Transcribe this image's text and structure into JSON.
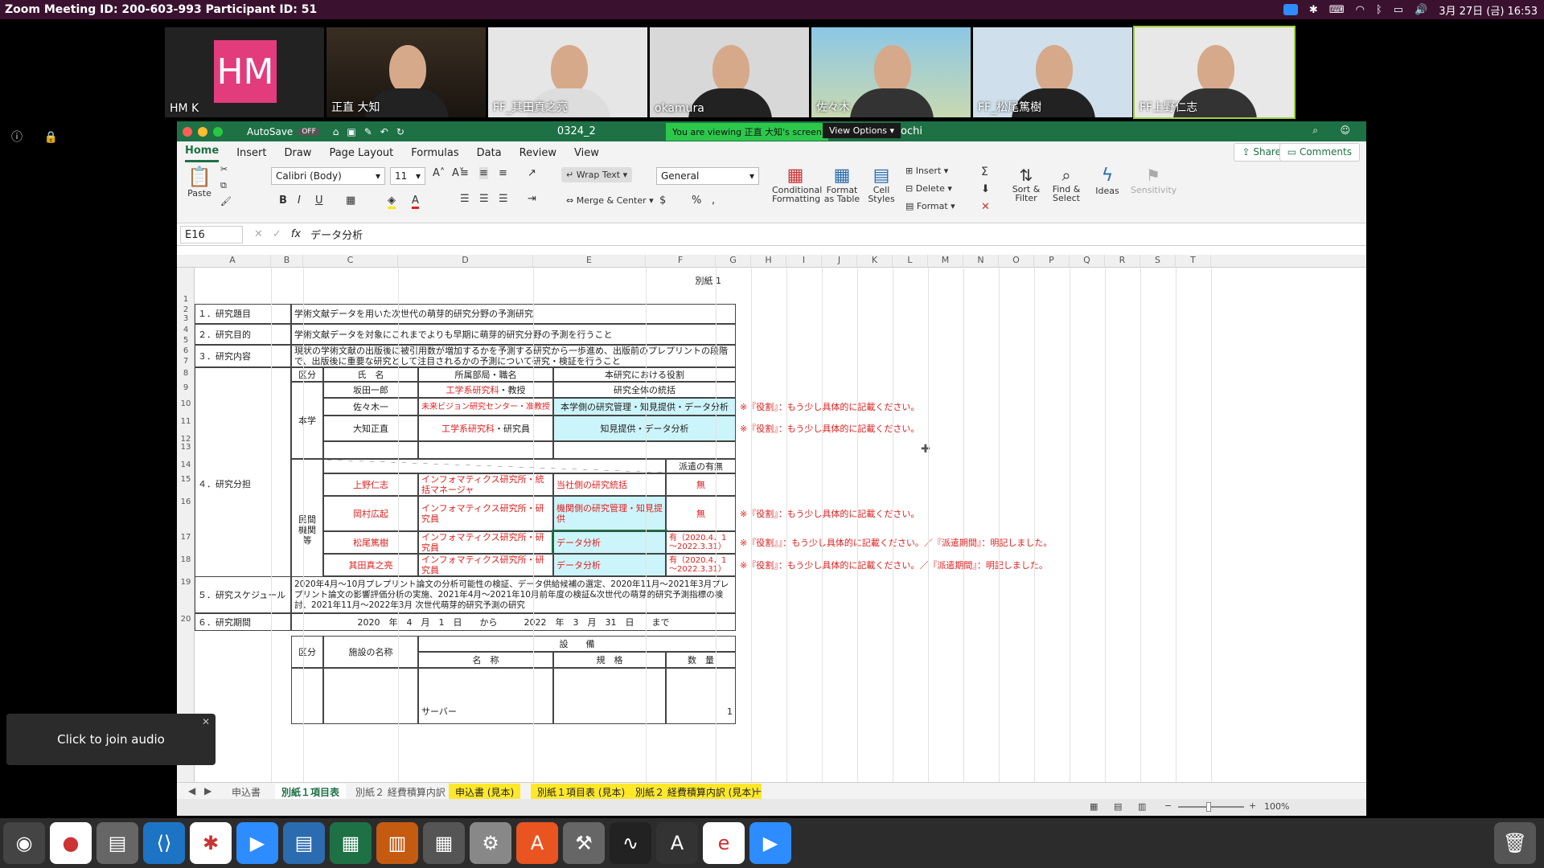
{
  "topbar": {
    "title": "Zoom Meeting ID: 200-603-993 Participant ID: 51",
    "datetime": "3月 27日 (금) 16:53"
  },
  "participants": [
    {
      "name": "HM K",
      "initials": "HM"
    },
    {
      "name": "正直 大知"
    },
    {
      "name": "FF_其田真之亮"
    },
    {
      "name": "okamura"
    },
    {
      "name": "佐々木"
    },
    {
      "name": "FF_松尾篤樹"
    },
    {
      "name": "FF上野仁志"
    }
  ],
  "excel": {
    "autosave": "AutoSave",
    "autosave_state": "OFF",
    "filename": "0324_2",
    "filename_tail": "ochi",
    "viewing_banner": "You are viewing 正直 大知's screen",
    "view_options": "View Options",
    "tabs": [
      "Home",
      "Insert",
      "Draw",
      "Page Layout",
      "Formulas",
      "Data",
      "Review",
      "View"
    ],
    "share": "Share",
    "comments": "Comments",
    "font": "Calibri (Body)",
    "font_size": "11",
    "number_format": "General",
    "ribbon": {
      "paste": "Paste",
      "wrap": "Wrap Text",
      "merge": "Merge & Center",
      "cond": "Conditional Formatting",
      "fmt_table": "Format as Table",
      "cell_styles": "Cell Styles",
      "insert": "Insert",
      "delete": "Delete",
      "format": "Format",
      "sort": "Sort & Filter",
      "find": "Find & Select",
      "ideas": "Ideas",
      "sensitivity": "Sensitivity"
    },
    "name_box": "E16",
    "formula": "データ分析",
    "columns": [
      "A",
      "B",
      "C",
      "D",
      "E",
      "F",
      "G",
      "H",
      "I",
      "J",
      "K",
      "L",
      "M",
      "N",
      "O",
      "P",
      "Q",
      "R",
      "S",
      "T"
    ],
    "rows": [
      "1",
      "2",
      "3",
      "4",
      "5",
      "6",
      "7",
      "8",
      "9",
      "10",
      "11",
      "12",
      "13",
      "14",
      "15",
      "16",
      "17",
      "18",
      "19",
      "20"
    ],
    "cells": {
      "besshi": "別紙 1",
      "r1_label": "１．研究題目",
      "r1_val": "学術文献データを用いた次世代の萌芽的研究分野の予測研究",
      "r2_label": "２．研究目的",
      "r2_val": "学術文献データを対象にこれまでよりも早期に萌芽的研究分野の予測を行うこと",
      "r3_label": "３．研究内容",
      "r3_val": "現状の学術文献の出版後に被引用数が増加するかを予測する研究から一歩進め、出版前のプレプリントの段階で、出版後に重要な研究として注目されるかの予測について研究・検証を行うこと",
      "r4_label": "４．研究分担",
      "h_kubun": "区分",
      "h_name": "氏　名",
      "h_dept": "所属部局・職名",
      "h_role": "本研究における役割",
      "honbu": "本学",
      "minkan": "民間機関等",
      "p1_name": "坂田一郎",
      "p1_dept": "工学系研究科",
      "p1_dept2": "・教授",
      "p1_role": "研究全体の統括",
      "p2_name": "佐々木一",
      "p2_dept": "未来ビジョン研究センター・准教授",
      "p2_role": "本学側の研究管理・知見提供・データ分析",
      "p2_note": "※『役割』：もう少し具体的に記載ください。",
      "p3_name": "大知正直",
      "p3_dept": "工学系研究科",
      "p3_dept2": "・研究員",
      "p3_role": "知見提供・データ分析",
      "p3_note": "※『役割』：もう少し具体的に記載ください。",
      "haken": "派遣の有無",
      "m1_name": "上野仁志",
      "m1_dept": "インフォマティクス研究所・統括マネージャ",
      "m1_role": "当社側の研究統括",
      "m1_haken": "無",
      "m2_name": "岡村広起",
      "m2_dept": "インフォマティクス研究所・研究員",
      "m2_role": "機関側の研究管理・知見提供",
      "m2_haken": "無",
      "m2_note": "※『役割』：もう少し具体的に記載ください。",
      "m3_name": "松尾篤樹",
      "m3_dept": "インフォマティクス研究所・研究員",
      "m3_role": "データ分析",
      "m3_haken": "有（2020.4．1～2022.3.31）",
      "m3_note": "※『役割』』：もう少し具体的に記載ください。／『派遣期間』：明記しました。",
      "m4_name": "其田真之亮",
      "m4_dept": "インフォマティクス研究所・研究員",
      "m4_role": "データ分析",
      "m4_haken": "有（2020.4．1～2022.3.31）",
      "m4_note": "※『役割』：もう少し具体的に記載ください。／『派遣期間』：明記しました。",
      "r5_label": "５．研究スケジュール",
      "r5_val": "2020年4月～10月プレプリント論文の分析可能性の検証、データ供給候補の選定、2020年11月～2021年3月プレプリント論文の影響評価分析の実施、2021年4月～2021年10月前年度の検証&次世代の萌芽的研究予測指標の検討、2021年11月～2022年3月 次世代萌芽的研究予測の研究",
      "r6_label": "６．研究期間",
      "r6_val": "2020　年　4　月　1　日　　から　　　2022　年　3　月　31　日　　まで",
      "setsubi": "設　　備",
      "shisetsu": "施設の名称",
      "meisho": "名　称",
      "kikaku": "規　格",
      "suryo": "数　量",
      "server": "サーバー",
      "server_qty": "1"
    },
    "sheets": [
      "申込書",
      "別紙１項目表",
      "別紙２ 経費積算内訳",
      "申込書 (見本)",
      "別紙１項目表 (見本)",
      "別紙２ 経費積算内訳 (見本)"
    ],
    "zoom": "100%"
  },
  "audio_tip": "Click to join audio",
  "dock": [
    "Ubuntu",
    "Chrome",
    "Files",
    "VS Code",
    "Slack",
    "Zoom",
    "Writer",
    "Calc",
    "Impress",
    "Calculator",
    "Settings",
    "Software",
    "Tweaks",
    "Monitor",
    "Updater",
    "Evince",
    "Zoom"
  ]
}
